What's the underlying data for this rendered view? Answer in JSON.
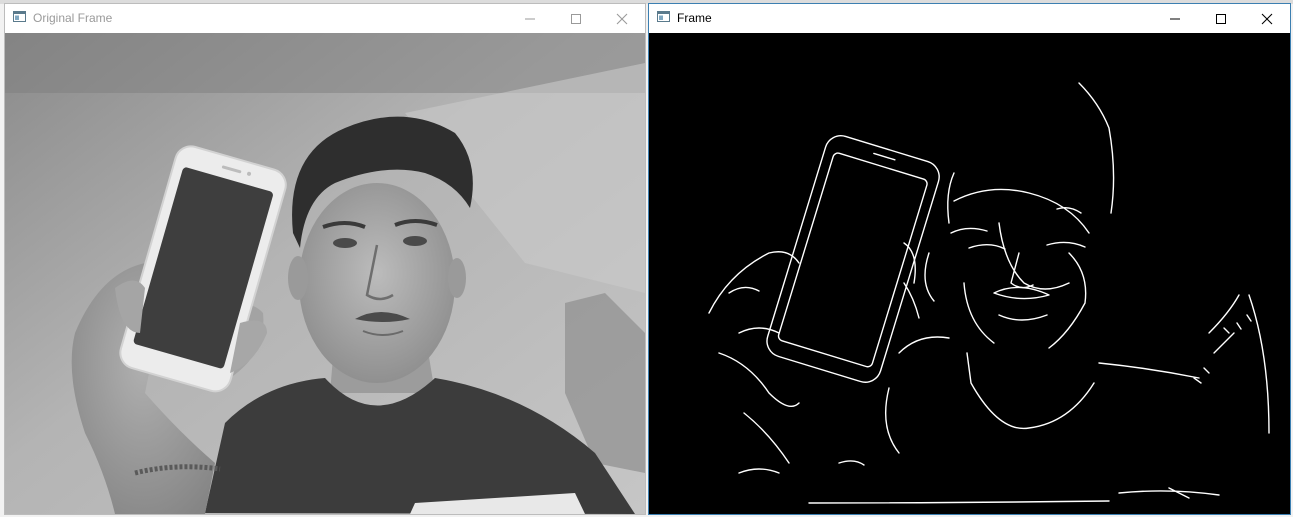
{
  "windows": [
    {
      "title": "Original Frame",
      "active": false,
      "content": "grayscale-webcam-frame",
      "controls": [
        "minimize-icon",
        "maximize-icon",
        "close-icon"
      ]
    },
    {
      "title": "Frame",
      "active": true,
      "content": "canny-edge-frame",
      "controls": [
        "minimize-icon",
        "maximize-icon",
        "close-icon"
      ]
    }
  ],
  "colors": {
    "active_border": "#3c7fb1",
    "inactive_title": "#9a9a9a",
    "edge_background": "#000000",
    "edge_lines": "#ffffff"
  }
}
